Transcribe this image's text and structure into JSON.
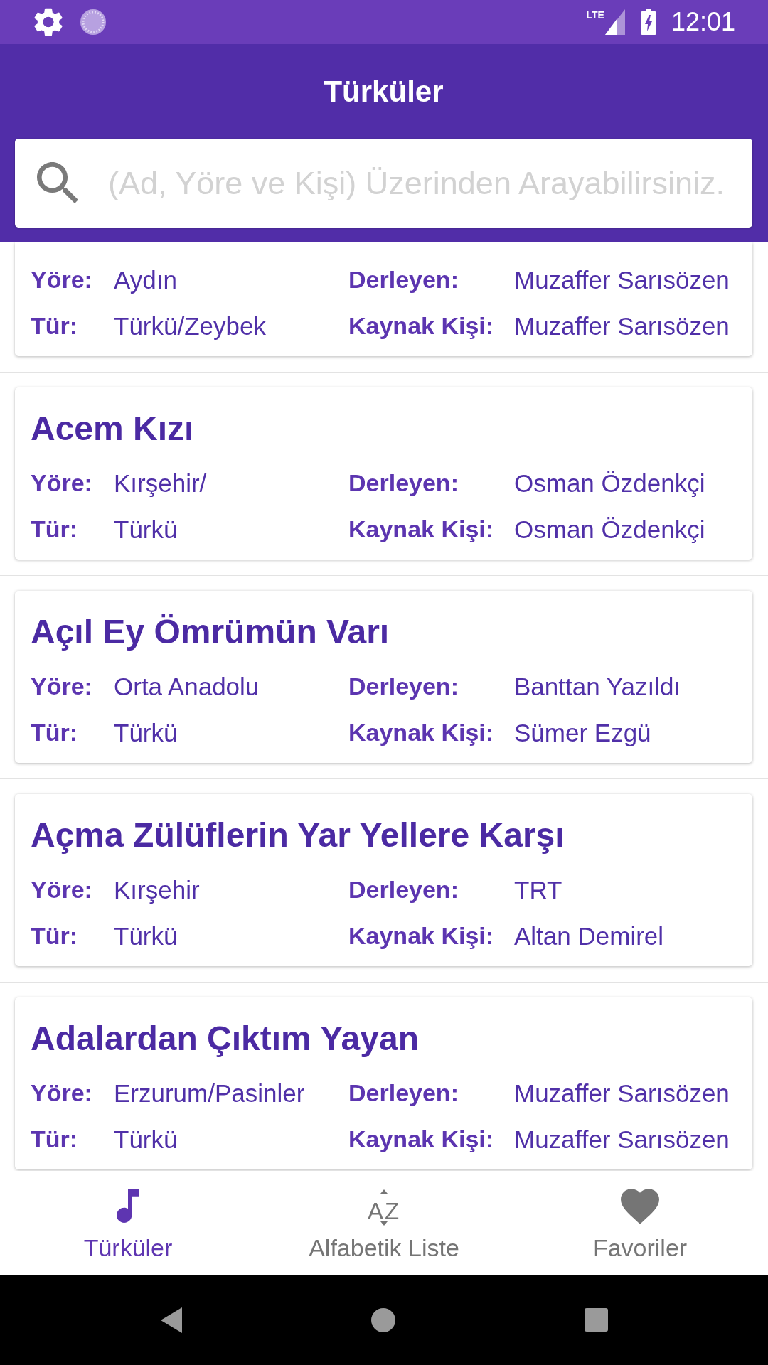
{
  "status_bar": {
    "network": "LTE",
    "time": "12:01"
  },
  "app_bar": {
    "title": "Türküler"
  },
  "search": {
    "placeholder": "(Ad, Yöre ve Kişi) Üzerinden Arayabilirsiniz."
  },
  "songs": [
    {
      "fields": [
        {
          "label": "Yöre:",
          "value": "Aydın"
        },
        {
          "label": "Derleyen:",
          "value": "Muzaffer Sarısözen"
        },
        {
          "label": "Tür:",
          "value": "Türkü/Zeybek"
        },
        {
          "label": "Kaynak Kişi:",
          "value": "Muzaffer Sarısözen"
        }
      ]
    },
    {
      "title": "Acem Kızı",
      "fields": [
        {
          "label": "Yöre:",
          "value": "Kırşehir/"
        },
        {
          "label": "Derleyen:",
          "value": "Osman Özdenkçi"
        },
        {
          "label": "Tür:",
          "value": "Türkü"
        },
        {
          "label": "Kaynak Kişi:",
          "value": "Osman Özdenkçi"
        }
      ]
    },
    {
      "title": "Açıl Ey Ömrümün Varı",
      "fields": [
        {
          "label": "Yöre:",
          "value": "Orta Anadolu"
        },
        {
          "label": "Derleyen:",
          "value": "Banttan Yazıldı"
        },
        {
          "label": "Tür:",
          "value": "Türkü"
        },
        {
          "label": "Kaynak Kişi:",
          "value": "Sümer Ezgü"
        }
      ]
    },
    {
      "title": "Açma Zülüflerin Yar Yellere Karşı",
      "fields": [
        {
          "label": "Yöre:",
          "value": "Kırşehir"
        },
        {
          "label": "Derleyen:",
          "value": "TRT"
        },
        {
          "label": "Tür:",
          "value": "Türkü"
        },
        {
          "label": "Kaynak Kişi:",
          "value": "Altan Demirel"
        }
      ]
    },
    {
      "title": "Adalardan Çıktım Yayan",
      "fields": [
        {
          "label": "Yöre:",
          "value": "Erzurum/Pasinler"
        },
        {
          "label": "Derleyen:",
          "value": "Muzaffer Sarısözen"
        },
        {
          "label": "Tür:",
          "value": "Türkü"
        },
        {
          "label": "Kaynak Kişi:",
          "value": "Muzaffer Sarısözen"
        }
      ]
    }
  ],
  "bottom_nav": [
    {
      "kind": "songs",
      "label": "Türküler",
      "selected": true
    },
    {
      "kind": "alphabetic",
      "label": "Alfabetik Liste",
      "icon_text": "AZ",
      "selected": false
    },
    {
      "kind": "favorites",
      "label": "Favoriler",
      "selected": false
    }
  ]
}
